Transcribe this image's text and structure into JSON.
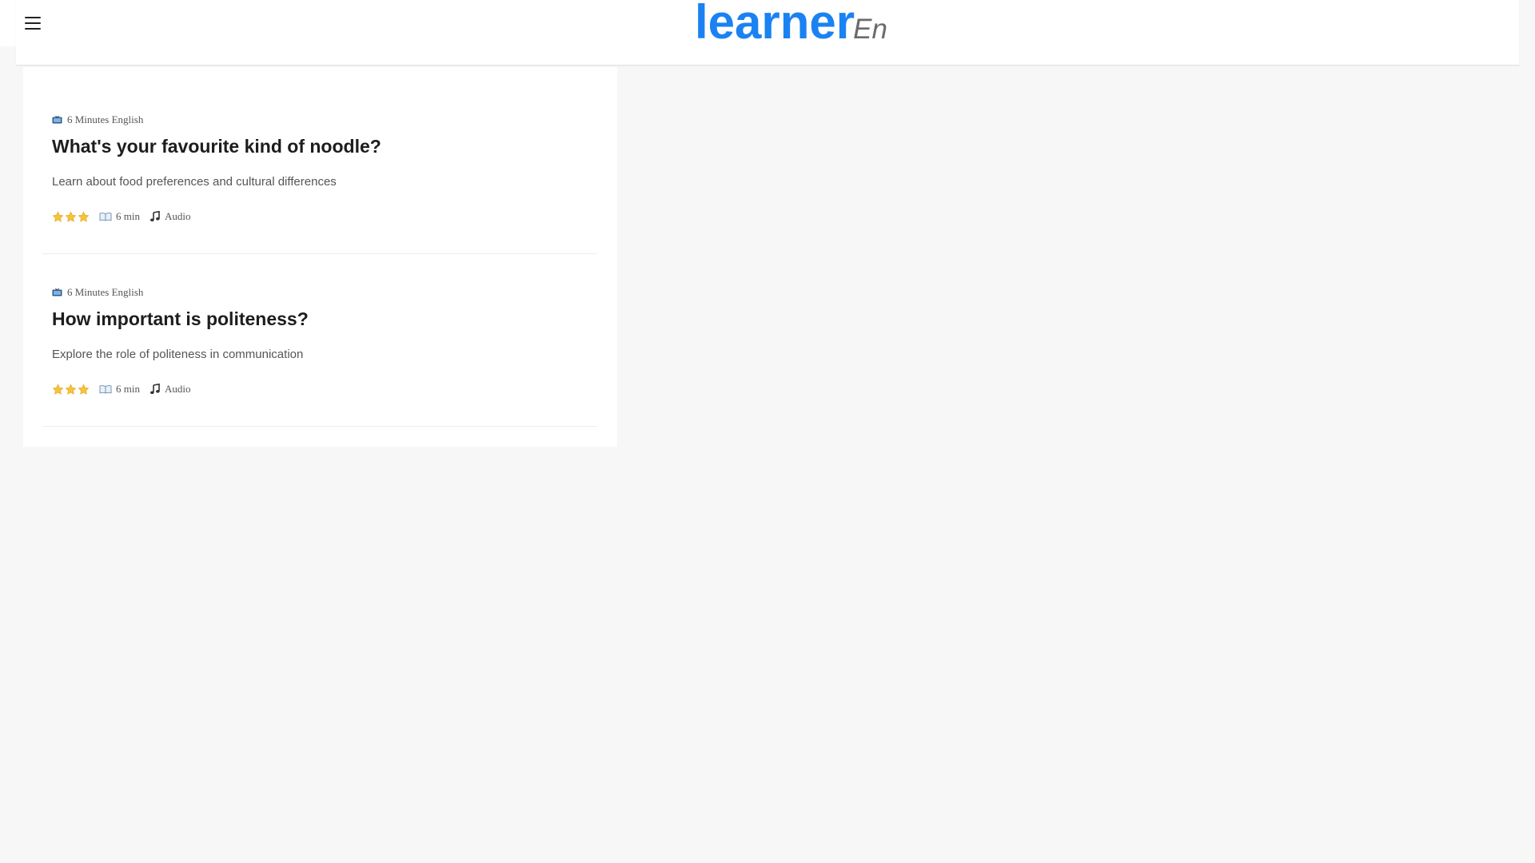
{
  "header": {
    "logo_main": "learner",
    "logo_suffix": "En",
    "brand_color": "#1a82f2"
  },
  "articles": [
    {
      "category": "6 Minutes English",
      "title": "What's your favourite kind of noodle?",
      "description": "Learn about food preferences and cultural differences",
      "stars": 3,
      "duration": "6 min",
      "media": "Audio"
    },
    {
      "category": "6 Minutes English",
      "title": "How important is politeness?",
      "description": "Explore the role of politeness in communication",
      "stars": 3,
      "duration": "6 min",
      "media": "Audio"
    }
  ],
  "icons": {
    "menu": "hamburger-menu-icon",
    "category": "tv-icon",
    "rating": "star-icon",
    "duration": "book-icon",
    "media": "music-note-icon"
  }
}
